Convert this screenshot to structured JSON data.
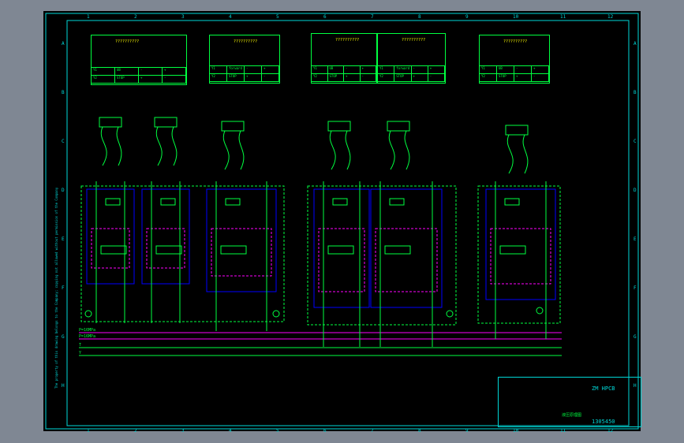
{
  "drawing": {
    "border_color": "#00d7d7",
    "background": "#000000",
    "frame_background": "#7f8793",
    "colors": {
      "circuit": "#00ff40",
      "block": "#0000ff",
      "pilot": "#ff00ff",
      "label": "#ffff00",
      "frame": "#00d7d7"
    },
    "column_numbers": [
      "1",
      "2",
      "3",
      "4",
      "5",
      "6",
      "7",
      "8",
      "9",
      "10",
      "11",
      "12"
    ],
    "row_letters": [
      "A",
      "B",
      "C",
      "D",
      "E",
      "F",
      "G",
      "H"
    ],
    "side_note": "The property of this drawing belongs to the Company; copying not allowed without permission of the Company",
    "line_labels": [
      "P=16MPa",
      "P=16MPa",
      "T",
      "Y"
    ],
    "title_block": {
      "drawing_number": "1305450",
      "logo_text": "ZM HPCB",
      "sheet_name": "液压原理图"
    }
  },
  "tables": [
    {
      "title": "??????????",
      "rows": [
        [
          "Y1",
          "UB",
          "-",
          "+"
        ],
        [
          "Y2",
          "STOP",
          "+",
          "-"
        ]
      ]
    },
    {
      "title": "??????????",
      "rows": [
        [
          "Y1",
          "forward",
          "-",
          "+"
        ],
        [
          "Y2",
          "STOP",
          "+",
          "-"
        ]
      ]
    },
    {
      "title": "??????????",
      "rows": [
        [
          "Y1",
          "UB",
          "-",
          "+"
        ],
        [
          "Y2",
          "STOP",
          "+",
          "-"
        ]
      ]
    },
    {
      "title": "??????????",
      "rows": [
        [
          "Y1",
          "forward",
          "-",
          "+"
        ],
        [
          "Y2",
          "STOP",
          "+",
          "-"
        ]
      ]
    },
    {
      "title": "??????????",
      "rows": [
        [
          "Y1",
          "UB",
          "-",
          "+"
        ],
        [
          "Y2",
          "STOP",
          "+",
          "-"
        ]
      ]
    }
  ]
}
